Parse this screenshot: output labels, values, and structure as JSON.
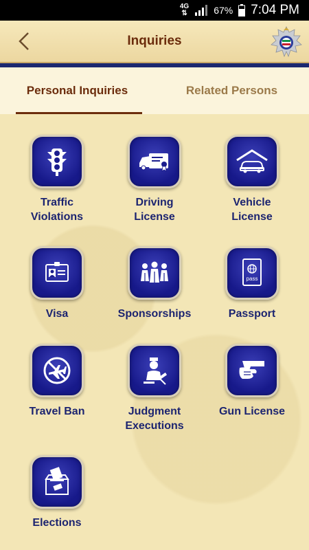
{
  "status_bar": {
    "network": "4G",
    "battery": "67%",
    "time": "7:04 PM"
  },
  "header": {
    "title": "Inquiries"
  },
  "tabs": [
    {
      "label": "Personal Inquiries",
      "active": true
    },
    {
      "label": "Related Persons",
      "active": false
    }
  ],
  "tiles": [
    {
      "label": "Traffic\nViolations",
      "icon": "traffic-light-icon"
    },
    {
      "label": "Driving\nLicense",
      "icon": "driving-license-icon"
    },
    {
      "label": "Vehicle\nLicense",
      "icon": "vehicle-garage-icon"
    },
    {
      "label": "Visa",
      "icon": "visa-card-icon"
    },
    {
      "label": "Sponsorships",
      "icon": "people-group-icon"
    },
    {
      "label": "Passport",
      "icon": "passport-icon"
    },
    {
      "label": "Travel Ban",
      "icon": "no-plane-icon"
    },
    {
      "label": "Judgment\nExecutions",
      "icon": "judge-gavel-icon"
    },
    {
      "label": "Gun License",
      "icon": "hand-gun-icon"
    },
    {
      "label": "Elections",
      "icon": "ballot-box-icon"
    }
  ],
  "icon_labels": {
    "passport_text": "pass"
  },
  "colors": {
    "title": "#6b2c0c",
    "tile_label": "#1c2470",
    "icon_bg": "#1b1d8e",
    "header_line": "#1b2870",
    "background": "#f3e6b6"
  }
}
